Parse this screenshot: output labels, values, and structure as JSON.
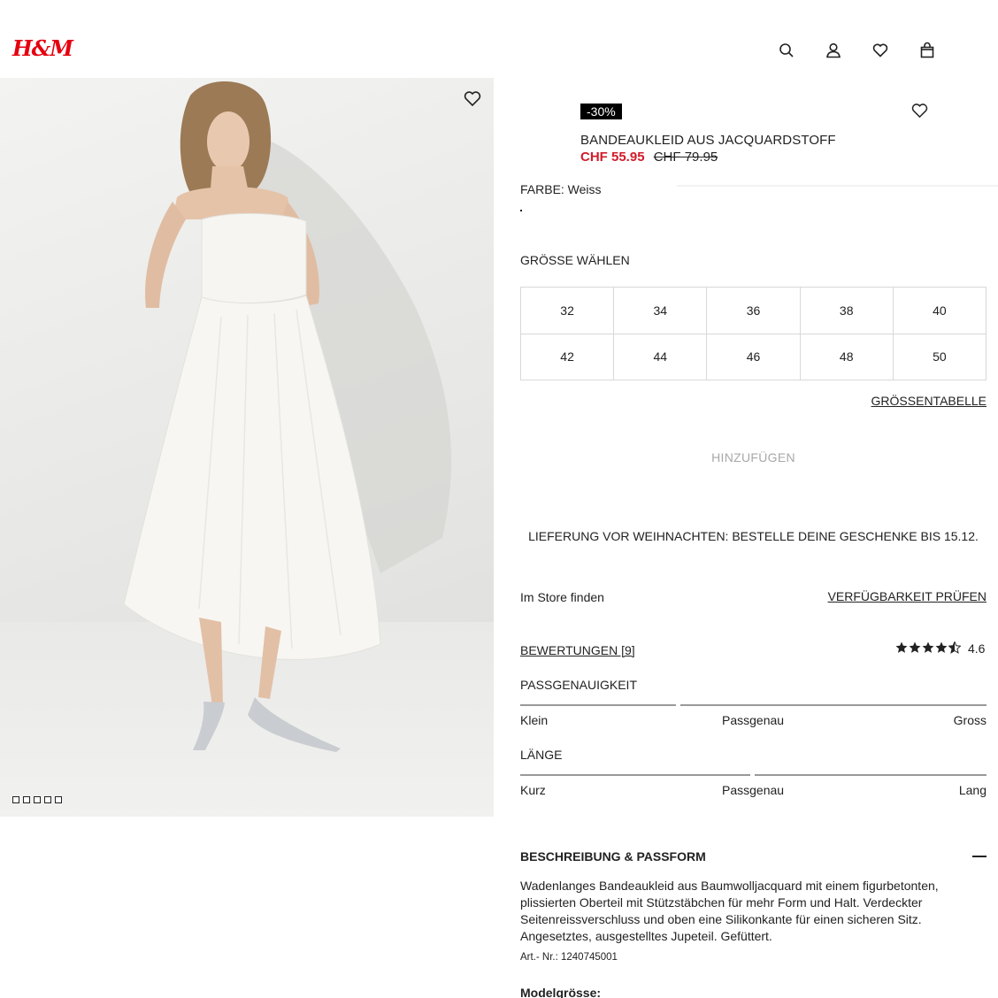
{
  "header": {
    "logo": "H&M",
    "icons": [
      "search-icon",
      "account-icon",
      "heart-icon",
      "bag-icon"
    ]
  },
  "gallery": {
    "dot_count": 5
  },
  "product": {
    "badge": "-30%",
    "title": "BANDEAUKLEID AUS JACQUARDSTOFF",
    "price_new": "CHF 55.95",
    "price_old": "CHF 79.95",
    "color_label": "FARBE: Weiss"
  },
  "size": {
    "label": "GRÖSSE WÄHLEN",
    "options": [
      "32",
      "34",
      "36",
      "38",
      "40",
      "42",
      "44",
      "46",
      "48",
      "50"
    ],
    "chart_link": "GRÖSSENTABELLE"
  },
  "add_button": "HINZUFÜGEN",
  "delivery_note": "LIEFERUNG VOR WEIHNACHTEN: BESTELLE DEINE GESCHENKE BIS 15.12.",
  "store": {
    "label": "Im Store finden",
    "link": "VERFÜGBARKEIT PRÜFEN"
  },
  "reviews": {
    "link": "BEWERTUNGEN [9]",
    "rating": "4.6",
    "stars": 4.5
  },
  "fit": {
    "heading": "PASSGENAUIGKEIT",
    "left": "Klein",
    "mid": "Passgenau",
    "right": "Gross"
  },
  "length": {
    "heading": "LÄNGE",
    "left": "Kurz",
    "mid": "Passgenau",
    "right": "Lang"
  },
  "description": {
    "heading": "BESCHREIBUNG & PASSFORM",
    "text": "Wadenlanges Bandeaukleid aus Baumwolljacquard mit einem figurbetonten, plissierten Oberteil mit Stützstäbchen für mehr Form und Halt. Verdeckter Seitenreissverschluss und oben eine Silikonkante für einen sicheren Sitz. Angesetztes, ausgestelltes Jupeteil. Gefüttert.",
    "art_nr": "Art.- Nr.: 1240745001",
    "model_heading": "Modelgrösse:"
  },
  "colors": {
    "brand_red": "#e50010",
    "sale_red": "#d11c2b",
    "text": "#222222"
  }
}
